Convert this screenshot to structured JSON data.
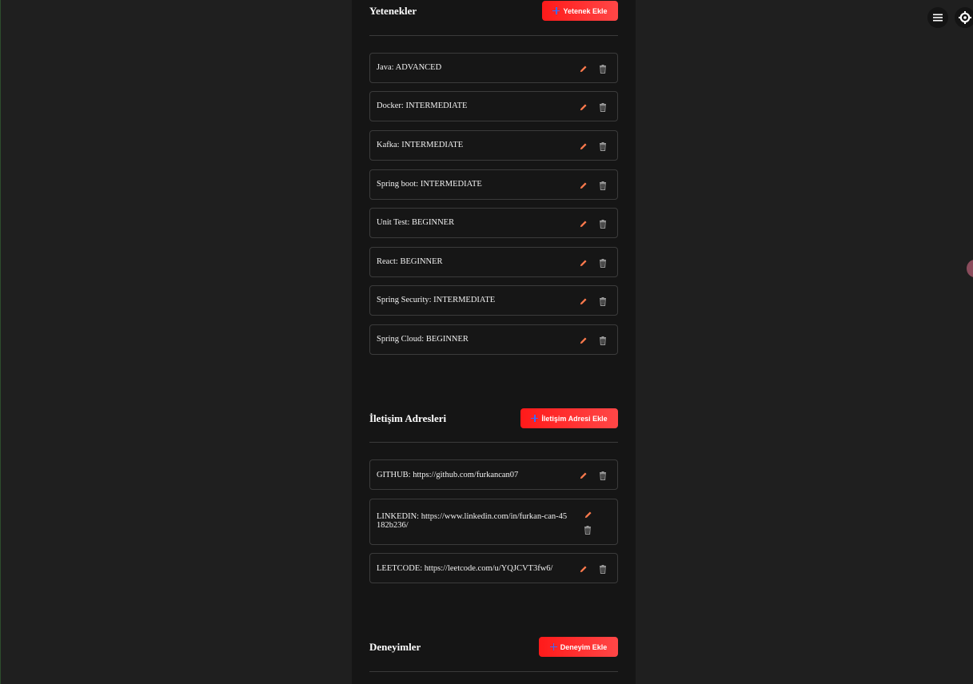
{
  "skills": {
    "title": "Yetenekler",
    "add_label": "Yetenek Ekle",
    "items": [
      {
        "text": "Java: ADVANCED"
      },
      {
        "text": "Docker: INTERMEDIATE"
      },
      {
        "text": "Kafka: INTERMEDIATE"
      },
      {
        "text": "Spring boot: INTERMEDIATE"
      },
      {
        "text": "Unit Test: BEGINNER"
      },
      {
        "text": "React: BEGINNER"
      },
      {
        "text": "Spring Security: INTERMEDIATE"
      },
      {
        "text": "Spring Cloud: BEGINNER"
      }
    ]
  },
  "contacts": {
    "title": "İletişim Adresleri",
    "add_label": "İletişim Adresi Ekle",
    "items": [
      {
        "text": "GITHUB: https://github.com/furkancan07"
      },
      {
        "text": "LINKEDIN: https://www.linkedin.com/in/furkan-can-45182b236/"
      },
      {
        "text": "LEETCODE: https://leetcode.com/u/YQJCVT3fw6/"
      }
    ]
  },
  "experiences": {
    "title": "Deneyimler",
    "add_label": "Deneyim Ekle"
  },
  "icons": {
    "menu": "menu-icon",
    "settings": "gear-icon",
    "edit": "pencil-icon",
    "delete": "trash-icon",
    "add": "plus-icon"
  },
  "colors": {
    "accent": "#ff2a2a",
    "edit_icon": "#ff7a4d",
    "delete_icon": "#9a9a9a",
    "plus_icon": "#3b6bff"
  }
}
